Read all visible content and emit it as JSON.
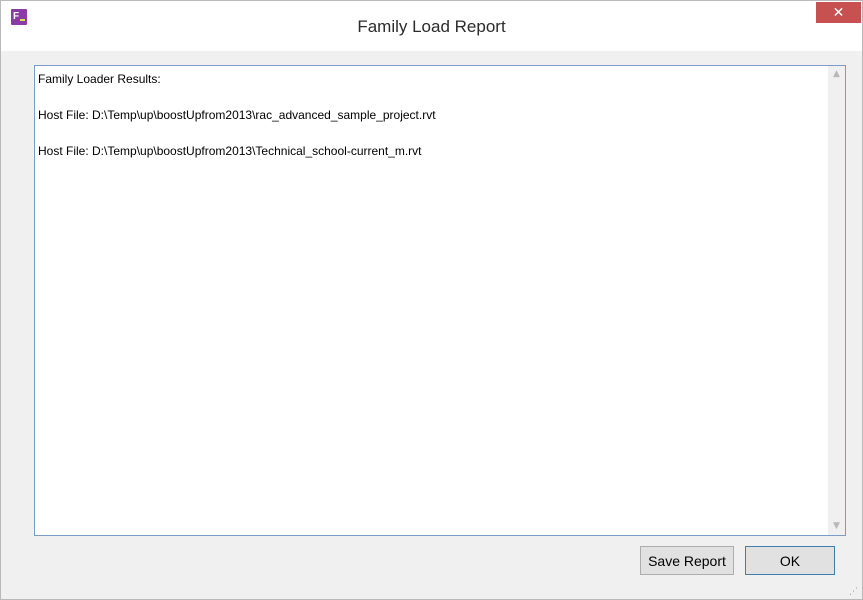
{
  "window": {
    "title": "Family Load Report",
    "app_icon": "family-loader-icon",
    "close_glyph": "✕"
  },
  "report": {
    "lines": [
      "Family Loader Results:",
      "Host File: D:\\Temp\\up\\boostUpfrom2013\\rac_advanced_sample_project.rvt",
      "Host File: D:\\Temp\\up\\boostUpfrom2013\\Technical_school-current_m.rvt"
    ],
    "scroll_up_glyph": "▲",
    "scroll_down_glyph": "▼"
  },
  "buttons": {
    "save_label": "Save Report",
    "ok_label": "OK"
  },
  "colors": {
    "accent_close": "#c75050",
    "app_icon": "#8c3aa8",
    "focus_border": "#7a9cc7"
  }
}
